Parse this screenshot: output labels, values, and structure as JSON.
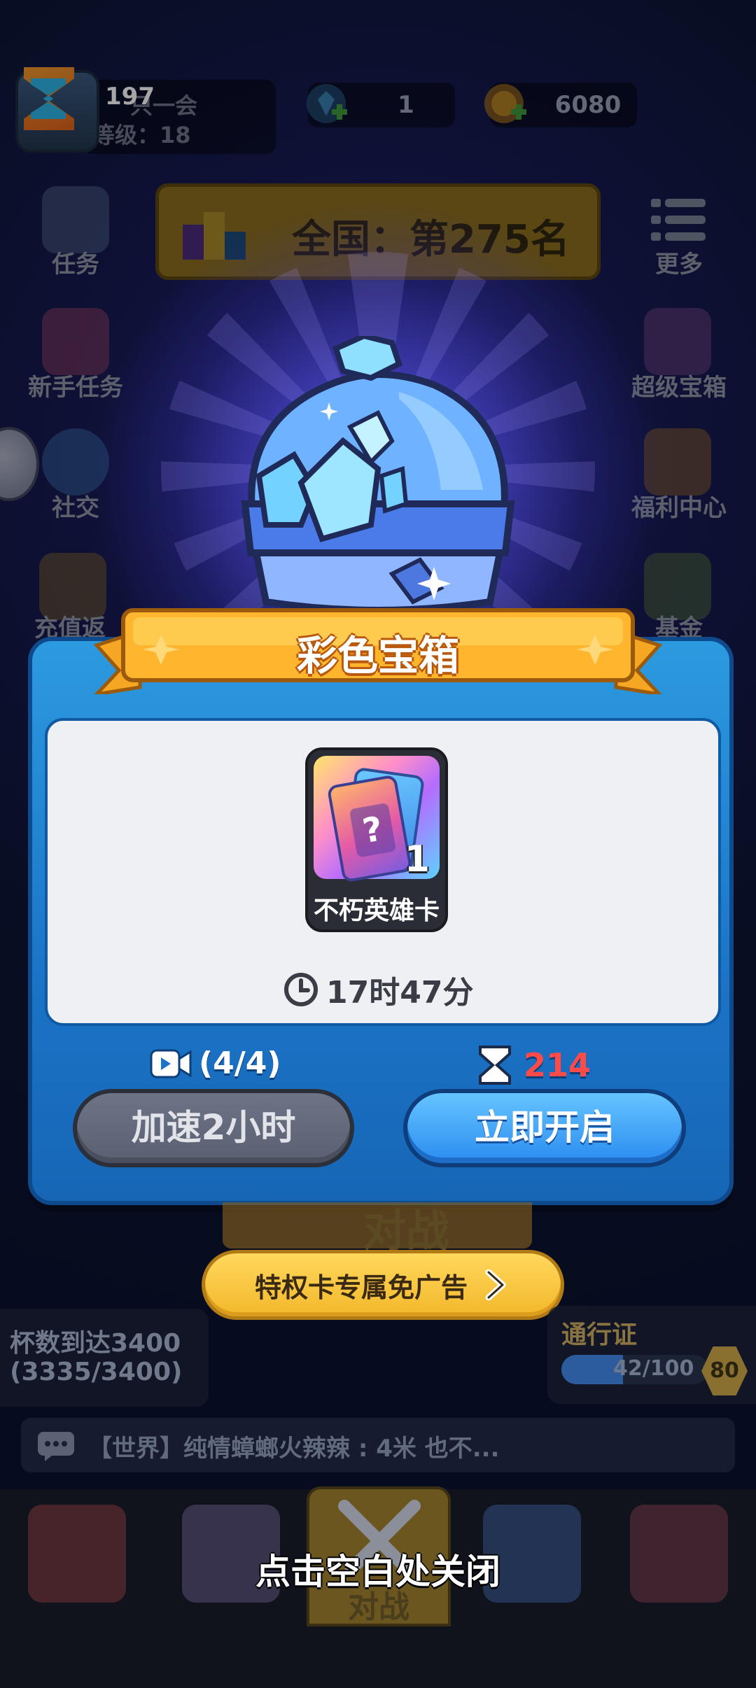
{
  "top_bar": {
    "ticket_count": "197",
    "player_name": "只一会",
    "player_level": "等级：18",
    "gems": "1",
    "coins": "6080"
  },
  "rank_banner": {
    "text": "全国：第275名"
  },
  "left_menu": [
    {
      "label": "任务",
      "icon": "clipboard-icon"
    },
    {
      "label": "新手任务",
      "icon": "calendar-icon"
    },
    {
      "label": "社交",
      "icon": "chat-face-icon"
    },
    {
      "label": "充值返",
      "icon": "stars-icon"
    }
  ],
  "right_menu": [
    {
      "label": "更多",
      "icon": "menu-list-icon"
    },
    {
      "label": "超级宝箱",
      "icon": "super-chest-icon"
    },
    {
      "label": "福利中心",
      "icon": "gift-icon"
    },
    {
      "label": "基金",
      "icon": "fund-icon"
    }
  ],
  "modal": {
    "title": "彩色宝箱",
    "reward": {
      "name": "不朽英雄卡",
      "count": "1",
      "mark": "?"
    },
    "timer": "17时47分",
    "ad_count": "(4/4)",
    "open_cost": "214",
    "speedup_label": "加速2小时",
    "open_label": "立即开启"
  },
  "behind_battle_label": "对战",
  "privilege_button": "特权卡专属免广告",
  "cup_goal": {
    "line1": "杯数到达3400",
    "line2": "(3335/3400)"
  },
  "pass": {
    "title": "通行证",
    "progress_text": "42/100",
    "progress_fraction": 0.42,
    "level": "80"
  },
  "chat": {
    "text": "【世界】纯情蟑螂火辣辣 : 4米 也不..."
  },
  "bottom_nav": {
    "battle_label": "对战"
  },
  "close_hint": "点击空白处关闭",
  "colors": {
    "modal_blue": "#1b74c7",
    "open_button": "#2a8cf0",
    "speedup_button": "#5a6072",
    "ribbon_orange": "#ffb52e",
    "cost_red": "#ff4a4a",
    "privilege_yellow": "#f3b72a"
  }
}
